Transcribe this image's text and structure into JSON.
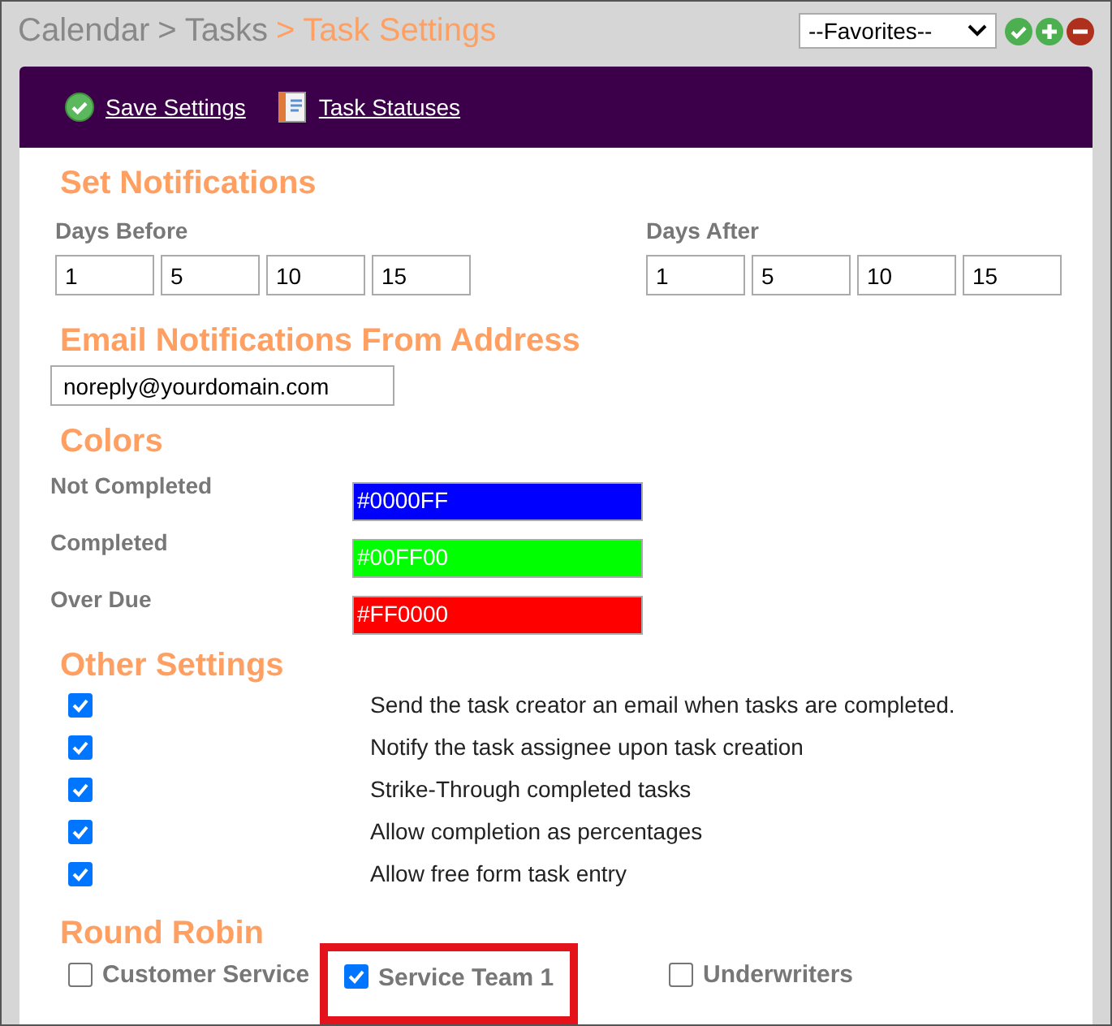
{
  "breadcrumb": [
    {
      "label": "Calendar",
      "current": false
    },
    {
      "label": "Tasks",
      "current": false,
      "separator": ">"
    },
    {
      "label": "Task Settings",
      "current": true,
      "separator": ">"
    }
  ],
  "favorites": {
    "value": "--Favorites--"
  },
  "toolbar": [
    {
      "label": "Save Settings",
      "kind": "save"
    },
    {
      "label": "Task Statuses",
      "kind": "notebook"
    }
  ],
  "notifications": {
    "heading": "Set Notifications",
    "groups": [
      {
        "label": "Days Before",
        "values": [
          "1",
          "5",
          "10",
          "15"
        ]
      },
      {
        "label": "Days After",
        "values": [
          "1",
          "5",
          "10",
          "15"
        ]
      }
    ]
  },
  "email": {
    "heading": "Email Notifications From Address",
    "value": "noreply@yourdomain.com"
  },
  "colors": {
    "heading": "Colors",
    "items": [
      {
        "label": "Not Completed",
        "value": "#0000FF",
        "color": "#0000ff"
      },
      {
        "label": "Completed",
        "value": "#00FF00",
        "color": "#00ff00"
      },
      {
        "label": "Over Due",
        "value": "#FF0000",
        "color": "#ff0000"
      }
    ]
  },
  "other_settings": {
    "heading": "Other Settings",
    "items": [
      {
        "label": "Send the task creator an email when tasks are completed.",
        "checked": true
      },
      {
        "label": "Notify the task assignee upon task creation",
        "checked": true
      },
      {
        "label": "Strike-Through completed tasks",
        "checked": true
      },
      {
        "label": "Allow completion as percentages",
        "checked": true
      },
      {
        "label": "Allow free form task entry",
        "checked": true
      }
    ]
  },
  "round_robin": {
    "heading": "Round Robin",
    "items": [
      {
        "label": "Customer Service",
        "checked": false,
        "highlighted": false
      },
      {
        "label": "Service Team 1",
        "checked": true,
        "highlighted": true
      },
      {
        "label": "Underwriters",
        "checked": false,
        "highlighted": false
      }
    ]
  }
}
